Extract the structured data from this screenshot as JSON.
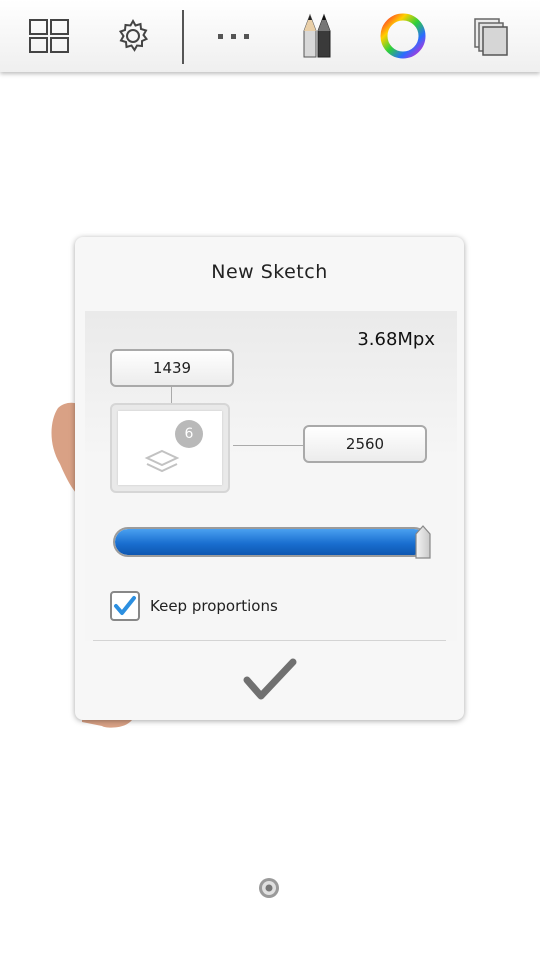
{
  "toolbar": {
    "icons": [
      "grid-icon",
      "gear-icon",
      "more-dots-icon",
      "brushes-icon",
      "color-wheel-icon",
      "layers-stack-icon"
    ]
  },
  "dialog": {
    "title": "New Sketch",
    "megapixels": "3.68Mpx",
    "height_value": "1439",
    "width_value": "2560",
    "layer_count": "6",
    "size_slider_fraction": 1.0,
    "keep_proportions_label": "Keep proportions",
    "keep_proportions_checked": true
  },
  "colors": {
    "accent_blue": "#1a6fd0",
    "checkmark_blue": "#2c8fe0",
    "paint_stroke": "#d9a185"
  }
}
